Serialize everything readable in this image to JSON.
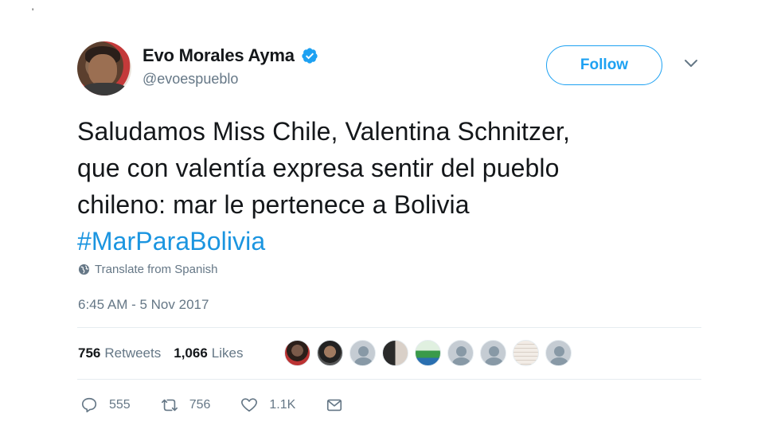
{
  "stray_mark": "'",
  "user": {
    "display_name": "Evo Morales Ayma",
    "handle": "@evoespueblo",
    "verified": true
  },
  "follow_label": "Follow",
  "tweet": {
    "lines": [
      "Saludamos Miss Chile, Valentina Schnitzer,",
      "que con valentía expresa sentir del pueblo",
      "chileno: mar le pertenece a Bolivia"
    ],
    "hashtag": "#MarParaBolivia"
  },
  "translate_label": "Translate from Spanish",
  "timestamp": "6:45 AM - 5 Nov 2017",
  "stats": {
    "retweets_count": "756",
    "retweets_label": "Retweets",
    "likes_count": "1,066",
    "likes_label": "Likes"
  },
  "likers": [
    {
      "kind": "photo1"
    },
    {
      "kind": "photo2"
    },
    {
      "kind": "default"
    },
    {
      "kind": "photo3"
    },
    {
      "kind": "flag"
    },
    {
      "kind": "default"
    },
    {
      "kind": "default"
    },
    {
      "kind": "doc"
    },
    {
      "kind": "default"
    }
  ],
  "actions": {
    "replies": "555",
    "retweets": "756",
    "likes": "1.1K"
  },
  "colors": {
    "accent": "#1da1f2",
    "hashtag": "#1b95e0",
    "muted": "#657786",
    "text": "#14171a"
  },
  "icons": [
    "verified-badge-icon",
    "chevron-down-icon",
    "globe-icon",
    "reply-icon",
    "retweet-icon",
    "heart-icon",
    "message-icon"
  ]
}
